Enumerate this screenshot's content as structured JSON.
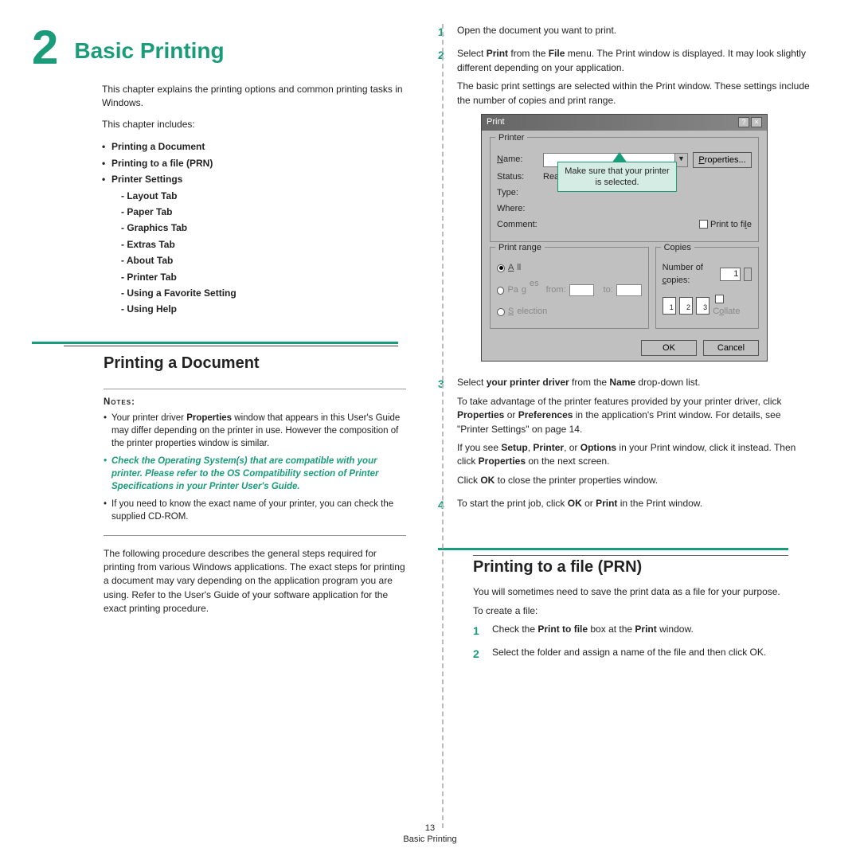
{
  "chapter": {
    "number": "2",
    "title": "Basic Printing"
  },
  "intro": {
    "p1": "This chapter explains the printing options and common printing tasks in Windows.",
    "p2": "This chapter includes:"
  },
  "toc": {
    "i1": "Printing a Document",
    "i2": "Printing to a file (PRN)",
    "i3": "Printer Settings",
    "s1": "Layout Tab",
    "s2": "Paper Tab",
    "s3": "Graphics Tab",
    "s4": "Extras Tab",
    "s5": "About Tab",
    "s6": "Printer Tab",
    "s7": "Using a Favorite Setting",
    "s8": "Using Help"
  },
  "sectionA": {
    "title": "Printing a Document"
  },
  "notes": {
    "label": "Notes",
    "n1a": "Your printer driver ",
    "n1b": "Properties",
    "n1c": " window that appears in this User's Guide may differ depending on the printer in use. However the composition of the printer properties window is similar.",
    "n2": "Check the Operating System(s) that are compatible with your printer. Please refer to the OS Compatibility section of Printer Specifications in your Printer User's Guide.",
    "n3": "If you need to know the exact name of your printer, you can check the supplied CD-ROM."
  },
  "paraA": "The following procedure describes the general steps required for printing from various Windows applications. The exact steps for printing a document may vary depending on the application program you are using. Refer to the User's Guide of your software application for the exact printing procedure.",
  "steps": {
    "s1": "Open the document you want to print.",
    "s2a": "Select ",
    "s2b": "Print",
    "s2c": " from the ",
    "s2d": "File",
    "s2e": " menu. The Print window is displayed. It may look slightly different depending on your application.",
    "s2p2": "The basic print settings are selected within the Print window. These settings include the number of copies and print range.",
    "s3a": "Select ",
    "s3b": "your printer driver",
    "s3c": " from the ",
    "s3d": "Name",
    "s3e": " drop-down list.",
    "s3p2a": "To take advantage of the printer features provided by your printer driver, click ",
    "s3p2b": "Properties",
    "s3p2c": " or ",
    "s3p2d": "Preferences",
    "s3p2e": " in the application's Print window. For details, see \"Printer Settings\" on page 14.",
    "s3p3a": "If you see ",
    "s3p3b": "Setup",
    "s3p3c": ", ",
    "s3p3d": "Printer",
    "s3p3e": ", or ",
    "s3p3f": "Options",
    "s3p3g": " in your Print window, click it instead. Then click ",
    "s3p3h": "Properties",
    "s3p3i": " on the next screen.",
    "s3p4a": "Click ",
    "s3p4b": "OK",
    "s3p4c": " to close the printer properties window.",
    "s4a": "To start the print job, click ",
    "s4b": "OK",
    "s4c": " or ",
    "s4d": "Print",
    "s4e": " in the Print window."
  },
  "dialog": {
    "title": "Print",
    "help": "?",
    "close": "×",
    "grp_printer": "Printer",
    "lbl_name": "Name:",
    "btn_props": "Properties...",
    "lbl_status": "Status:",
    "val_status": "Read",
    "lbl_type": "Type:",
    "lbl_where": "Where:",
    "lbl_comment": "Comment:",
    "chk_printfile": "Print to file",
    "callout": "Make sure that your printer is selected.",
    "grp_range": "Print range",
    "opt_all": "All",
    "opt_pages": "Pages",
    "lbl_from": "from:",
    "lbl_to": "to:",
    "opt_selection": "Selection",
    "grp_copies": "Copies",
    "lbl_numcopies": "Number of copies:",
    "val_copies": "1",
    "p1": "1",
    "p2": "2",
    "p3": "3",
    "chk_collate": "Collate",
    "btn_ok": "OK",
    "btn_cancel": "Cancel"
  },
  "sectionB": {
    "title": "Printing to a file (PRN)",
    "p1": "You will sometimes need to save the print data as a file for your purpose.",
    "p2": "To create a file:",
    "s1a": "Check the ",
    "s1b": "Print to file",
    "s1c": " box at the ",
    "s1d": "Print",
    "s1e": " window.",
    "s2": "Select the folder and assign a name of the file and then click OK."
  },
  "footer": {
    "page": "13",
    "title": "Basic Printing"
  }
}
